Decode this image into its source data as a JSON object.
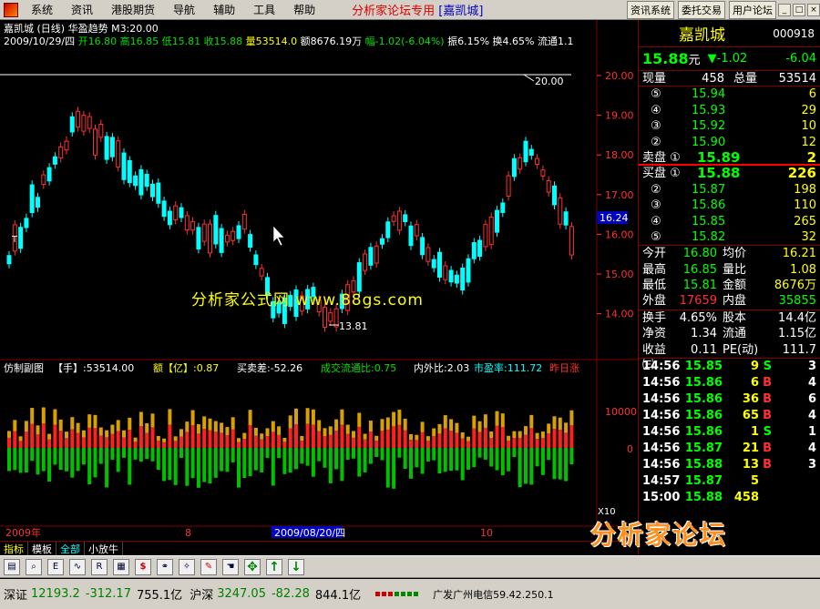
{
  "menu": {
    "items": [
      "系统",
      "资讯",
      "港股期货",
      "导航",
      "辅助",
      "工具",
      "帮助"
    ],
    "forum_title": "分析家论坛专用",
    "forum_stock": "[嘉凯城]",
    "right_buttons": [
      "资讯系统",
      "委托交易",
      "用户论坛"
    ]
  },
  "chart": {
    "header1": "嘉凯城 (日线) 华盈趋势 M3:20.00",
    "date": "2009/10/29/四",
    "open_label": "开16.80",
    "high_label": "高16.85",
    "low_label": "低15.81",
    "close_label": "收15.88",
    "volume_label": "量53514.0",
    "amount_label": "额8676.19万",
    "change_label": "幅-1.02(-6.04%)",
    "amplitude_label": "振6.15%",
    "turnover_label": "换4.65%",
    "float_label": "流通1.1",
    "price_axis": [
      "20.00",
      "19.00",
      "18.00",
      "17.00",
      "16.00",
      "15.00",
      "14.00"
    ],
    "current_price_tag": "16.24",
    "high_marker": "20.00",
    "low_marker": "13.81",
    "watermark": "分析家公式网 www.88gs.com",
    "t_marker": "T",
    "sub_header": {
      "name": "仿制副图",
      "hand": "【手】:53514.00",
      "yi": "额【亿】:0.87",
      "diff": "买卖差:-52.26",
      "ratio": "成交流通比:0.75",
      "inner": "内外比:2.03",
      "pe": "市盈率:111.72",
      "yesterday": "昨日涨"
    },
    "sub_axis": [
      "10000",
      "0"
    ],
    "sub_scale": "X10",
    "date_axis": {
      "year": "2009年",
      "m8": "8",
      "cursor_date": "2009/08/20/四",
      "m10": "10"
    }
  },
  "bottom_tabs": [
    "指标",
    "模板",
    "全部",
    "小放牛"
  ],
  "quote": {
    "name": "嘉凯城",
    "code": "000918",
    "price": "15.88",
    "unit": "元",
    "change": "▼-1.02",
    "change_pct": "-6.04",
    "now_vol_label": "现量",
    "now_vol": "458",
    "total_vol_label": "总量",
    "total_vol": "53514",
    "sell_levels": [
      {
        "lvl": "⑤",
        "price": "15.94",
        "vol": "6"
      },
      {
        "lvl": "④",
        "price": "15.93",
        "vol": "29"
      },
      {
        "lvl": "③",
        "price": "15.92",
        "vol": "10"
      },
      {
        "lvl": "②",
        "price": "15.90",
        "vol": "12"
      }
    ],
    "sell1": {
      "label": "卖盘 ①",
      "price": "15.89",
      "vol": "2"
    },
    "buy1": {
      "label": "买盘 ①",
      "price": "15.88",
      "vol": "226"
    },
    "buy_levels": [
      {
        "lvl": "②",
        "price": "15.87",
        "vol": "198"
      },
      {
        "lvl": "③",
        "price": "15.86",
        "vol": "110"
      },
      {
        "lvl": "④",
        "price": "15.85",
        "vol": "265"
      },
      {
        "lvl": "⑤",
        "price": "15.82",
        "vol": "32"
      }
    ],
    "stats": [
      {
        "k1": "今开",
        "v1": "16.80",
        "k2": "均价",
        "v2": "16.21"
      },
      {
        "k1": "最高",
        "v1": "16.85",
        "k2": "量比",
        "v2": "1.08"
      },
      {
        "k1": "最低",
        "v1": "15.81",
        "k2": "金额",
        "v2": "8676万"
      },
      {
        "k1": "外盘",
        "v1": "17659",
        "k2": "内盘",
        "v2": "35855"
      }
    ],
    "stats2": [
      {
        "k1": "换手",
        "v1": "4.65%",
        "k2": "股本",
        "v2": "14.4亿"
      },
      {
        "k1": "净资",
        "v1": "1.34",
        "k2": "流通",
        "v2": "1.15亿"
      },
      {
        "k1": "收益㈢",
        "v1": "0.11",
        "k2": "PE(动)",
        "v2": "111.7"
      }
    ],
    "ticks": [
      {
        "t": "14:56",
        "p": "15.85",
        "n": "9",
        "s": "S",
        "c": "3"
      },
      {
        "t": "14:56",
        "p": "15.86",
        "n": "6",
        "s": "B",
        "c": "4"
      },
      {
        "t": "14:56",
        "p": "15.86",
        "n": "36",
        "s": "B",
        "c": "6"
      },
      {
        "t": "14:56",
        "p": "15.86",
        "n": "65",
        "s": "B",
        "c": "4"
      },
      {
        "t": "14:56",
        "p": "15.86",
        "n": "1",
        "s": "S",
        "c": "1"
      },
      {
        "t": "14:56",
        "p": "15.87",
        "n": "21",
        "s": "B",
        "c": "4"
      },
      {
        "t": "14:56",
        "p": "15.88",
        "n": "13",
        "s": "B",
        "c": "3"
      },
      {
        "t": "14:57",
        "p": "15.87",
        "n": "5",
        "s": "",
        "c": ""
      },
      {
        "t": "15:00",
        "p": "15.88",
        "n": "458",
        "s": "",
        "c": ""
      }
    ]
  },
  "logo": {
    "text": "分析家论坛",
    "url": "bbs.88gs.com"
  },
  "toolbar": {
    "icons": [
      "chart-icon",
      "zoom-icon",
      "eit-icon",
      "line-icon",
      "rsi-icon",
      "grid-icon",
      "dollar-icon",
      "link-icon",
      "tools-icon",
      "pencil-icon",
      "hand-icon",
      "move-icon",
      "up-icon",
      "down-icon"
    ]
  },
  "status": {
    "sz_label": "深证",
    "sz_index": "12193.2",
    "sz_change": "-312.17",
    "sz_amount": "755.1亿",
    "hs_label": "沪深",
    "hs_index": "3247.05",
    "hs_change": "-82.28",
    "hs_amount": "844.1亿",
    "ticker": "广发广州电信59.42.250.1"
  },
  "colors": {
    "up": "#ff3030",
    "down": "#00ffff",
    "text_green": "#00ff00",
    "text_yellow": "#ffff00",
    "frame": "#800000"
  }
}
